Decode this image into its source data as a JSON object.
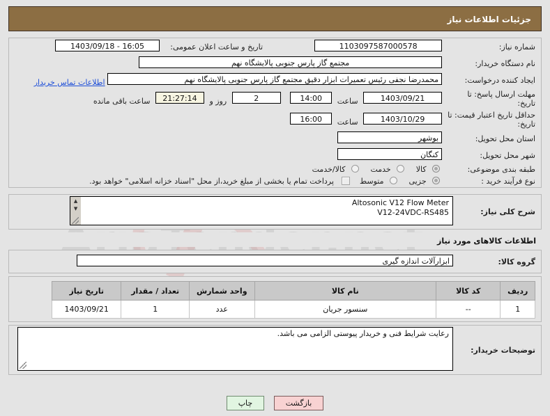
{
  "header": {
    "title": "جزئیات اطلاعات نیاز"
  },
  "form": {
    "need_number": {
      "label": "شماره نیاز:",
      "value": "1103097587000578"
    },
    "announce_datetime": {
      "label": "تاریخ و ساعت اعلان عمومی:",
      "value": "16:05 - 1403/09/18"
    },
    "buyer_org": {
      "label": "نام دستگاه خریدار:",
      "value": "مجتمع گاز پارس جنوبی  پالایشگاه نهم"
    },
    "creator": {
      "label": "ایجاد کننده درخواست:",
      "value": "محمدرضا نجفی رئیس تعمیرات ابزار دقیق مجتمع گاز پارس جنوبی  پالایشگاه نهم",
      "contact_link": "اطلاعات تماس خریدار"
    },
    "response_deadline": {
      "label_line1": "مهلت ارسال پاسخ: تا",
      "label_line2": "تاریخ:",
      "date": "1403/09/21",
      "hour_label": "ساعت",
      "hour": "14:00",
      "days": "2",
      "days_sep": "روز و",
      "countdown": "21:27:14",
      "remaining_label": "ساعت باقی مانده"
    },
    "price_validity": {
      "label_line1": "حداقل تاریخ اعتبار قیمت: تا",
      "label_line2": "تاریخ:",
      "date": "1403/10/29",
      "hour_label": "ساعت",
      "hour": "16:00"
    },
    "province": {
      "label": "استان محل تحویل:",
      "value": "بوشهر"
    },
    "city": {
      "label": "شهر محل تحویل:",
      "value": "کنگان"
    },
    "subject_class": {
      "label": "طبقه بندی موضوعی:",
      "options": [
        "کالا",
        "خدمت",
        "کالا/خدمت"
      ],
      "selected": "کالا"
    },
    "purchase_type": {
      "label": "نوع فرآیند خرید :",
      "options": [
        "جزیی",
        "متوسط",
        "پرداخت تمام یا بخشی از مبلغ خرید،از محل \"اسناد خزانه اسلامی\" خواهد بود."
      ],
      "selected": "جزیی",
      "checkbox_label": "پرداخت تمام یا بخشی از مبلغ خرید،از محل \"اسناد خزانه اسلامی\" خواهد بود.",
      "checkbox_checked": false
    },
    "description": {
      "label": "شرح کلی نیاز:",
      "value": "Altosonic V12 Flow Meter\nV12-24VDC-RS485"
    },
    "goods_section_title": "اطلاعات کالاهای مورد نیاز",
    "goods_group": {
      "label": "گروه کالا:",
      "value": "ابزارآلات اندازه گیری"
    },
    "buyer_notes": {
      "label": "توضیحات خریدار:",
      "value": "رعایت شرایط فنی و خریدار پیوستی الزامی می باشد."
    }
  },
  "goods_table": {
    "columns": [
      "ردیف",
      "کد کالا",
      "نام کالا",
      "واحد شمارش",
      "تعداد / مقدار",
      "تاریخ نیاز"
    ],
    "rows": [
      [
        "1",
        "--",
        "سنسور جریان",
        "عدد",
        "1",
        "1403/09/21"
      ]
    ]
  },
  "footer": {
    "back_label": "بازگشت",
    "print_label": "چاپ"
  },
  "watermark": {
    "text": "AriaTender.net"
  },
  "colors": {
    "header_bg": "#8c6e43",
    "page_bg": "#e4e4e4",
    "link": "#1d4ed8",
    "back_btn": "#f8d2d2",
    "print_btn": "#e1f5e1",
    "countdown_bg": "#f7f5e2",
    "table_header_bg": "#c9c9c9"
  }
}
